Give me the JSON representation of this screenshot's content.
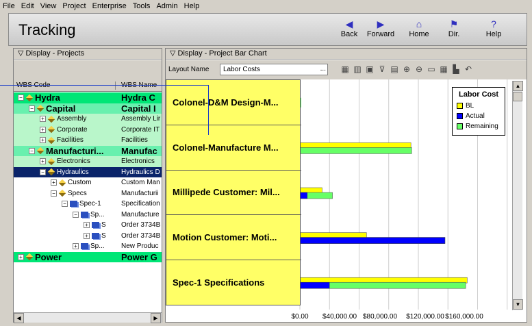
{
  "menu": [
    "File",
    "Edit",
    "View",
    "Project",
    "Enterprise",
    "Tools",
    "Admin",
    "Help"
  ],
  "title": "Tracking",
  "toolbar": [
    {
      "label": "Back",
      "icon": "back-arrow-icon",
      "glyph": "◀"
    },
    {
      "label": "Forward",
      "icon": "forward-arrow-icon",
      "glyph": "▶"
    },
    {
      "label": "Home",
      "icon": "home-icon",
      "glyph": "⌂"
    },
    {
      "label": "Dir.",
      "icon": "directory-icon",
      "glyph": "⚑"
    },
    {
      "label": "Help",
      "icon": "help-icon",
      "glyph": "?"
    }
  ],
  "left_pane": {
    "header": "Display - Projects",
    "col1": "WBS Code",
    "col2": "WBS Name"
  },
  "right_pane": {
    "header": "Display - Project Bar Chart",
    "layout_label": "Layout Name",
    "layout_value": "Labor Costs",
    "browse": "..."
  },
  "tree": [
    {
      "level": 0,
      "pm": "−",
      "icon": "dia",
      "code": "Hydra",
      "name": "Hydra C",
      "bold": true,
      "bg": "#00e676"
    },
    {
      "level": 1,
      "pm": "−",
      "icon": "dia",
      "code": "Capital",
      "name": "Capital I",
      "bold": true,
      "bg": "#69f0ae"
    },
    {
      "level": 2,
      "pm": "+",
      "icon": "dia",
      "code": "Assembly",
      "name": "Assembly Lir",
      "bold": false,
      "bg": "#b9f6ca"
    },
    {
      "level": 2,
      "pm": "+",
      "icon": "dia",
      "code": "Corporate",
      "name": "Corporate IT",
      "bold": false,
      "bg": "#b9f6ca"
    },
    {
      "level": 2,
      "pm": "+",
      "icon": "dia",
      "code": "Facilities",
      "name": "Facilities",
      "bold": false,
      "bg": "#b9f6ca"
    },
    {
      "level": 1,
      "pm": "−",
      "icon": "dia",
      "code": "Manufacturi...",
      "name": "Manufac",
      "bold": true,
      "bg": "#69f0ae"
    },
    {
      "level": 2,
      "pm": "+",
      "icon": "dia",
      "code": "Electronics",
      "name": "Electronics",
      "bold": false,
      "bg": "#b9f6ca"
    },
    {
      "level": 2,
      "pm": "−",
      "icon": "dia",
      "code": "Hydraulics",
      "name": "Hydraulics D",
      "bold": false,
      "bg": "#0a246a",
      "sel": true
    },
    {
      "level": 3,
      "pm": "+",
      "icon": "dia",
      "code": "Custom",
      "name": "Custom Man",
      "bold": false,
      "bg": "#ffffff"
    },
    {
      "level": 3,
      "pm": "−",
      "icon": "dia",
      "code": "Specs",
      "name": "Manufacturii",
      "bold": false,
      "bg": "#ffffff"
    },
    {
      "level": 4,
      "pm": "−",
      "icon": "sheet",
      "code": "Spec-1",
      "name": "Specification",
      "bold": false,
      "bg": "#ffffff"
    },
    {
      "level": 5,
      "pm": "−",
      "icon": "sheet",
      "code": "Sp...",
      "name": "Manufacture",
      "bold": false,
      "bg": "#ffffff"
    },
    {
      "level": 6,
      "pm": "+",
      "icon": "sheet",
      "code": "S",
      "name": "Order 3734B",
      "bold": false,
      "bg": "#ffffff"
    },
    {
      "level": 6,
      "pm": "+",
      "icon": "sheet",
      "code": "S",
      "name": "Order 3734B",
      "bold": false,
      "bg": "#ffffff"
    },
    {
      "level": 5,
      "pm": "+",
      "icon": "sheet",
      "code": "Sp...",
      "name": "New Produc",
      "bold": false,
      "bg": "#ffffff"
    },
    {
      "level": 0,
      "pm": "+",
      "icon": "dia",
      "code": "Power",
      "name": "Power G",
      "bold": true,
      "bg": "#00e676"
    }
  ],
  "chart_data": {
    "type": "bar",
    "orientation": "horizontal",
    "categories": [
      "Colonel-D&M Design-M...",
      "Colonel-Manufacture M...",
      "Millipede Customer: Mil...",
      "Motion Customer: Moti...",
      "Spec-1 Specifications"
    ],
    "series": [
      {
        "name": "BL",
        "color": "#ffff00",
        "values": [
          0,
          150000,
          30000,
          90000,
          226000
        ]
      },
      {
        "name": "Actual",
        "color": "#0000ff",
        "values": [
          0,
          0,
          10000,
          196000,
          40000
        ]
      },
      {
        "name": "Remaining",
        "color": "#66ff66",
        "values": [
          0,
          151000,
          44000,
          196000,
          224000
        ]
      }
    ],
    "legend_title": "Labor Cost",
    "xticks": [
      "$0.00",
      "$40,000.00",
      "$80,000.00",
      "$120,000.00",
      "$160,000.00"
    ],
    "xlim": [
      0,
      160000
    ],
    "grid": true,
    "legend_position": "top-right"
  }
}
